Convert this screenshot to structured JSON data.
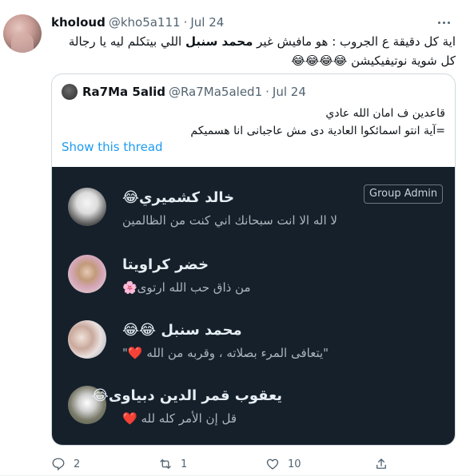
{
  "tweet": {
    "display_name": "kholoud",
    "handle": "@kho5a111",
    "dot": "·",
    "time": "Jul 24",
    "text_part1": "اية كل دقيقة ع الجروب : هو مافيش غير ",
    "text_bold": "محمد سنبل",
    "text_part2": " اللي بيتكلم ليه يا رجالة كل شوية نوتيفيكيشن 😂😂😂😂"
  },
  "quote": {
    "display_name": "Ra7Ma 5alid",
    "handle": "@Ra7Ma5aled1",
    "dot": "·",
    "time": "Jul 24",
    "line1": "قاعدين ف امان الله عادي",
    "line2": "=آية انتو اسمائكوا العادية دى مش عاجبانى انا هسميكم",
    "show_thread": "Show this thread"
  },
  "group": {
    "admin_badge": "Group Admin",
    "members": [
      {
        "name": "خالد كشميري😂",
        "status": "لا اله الا انت سبحانك اني كنت من الظالمين"
      },
      {
        "name": "خضر كراويتا",
        "status": "من ذاق حب الله ارتوى🌸"
      },
      {
        "name": "محمد سنبل 😂😂",
        "status": "\"يتعافى المرء بصلاته ، وقربه من الله ❤️\""
      },
      {
        "name": "يعقوب قمر الدين دبياوى😂",
        "status": "قل إن الأمر كله لله ❤️"
      }
    ]
  },
  "actions": {
    "replies": "2",
    "retweets": "1",
    "likes": "10"
  }
}
